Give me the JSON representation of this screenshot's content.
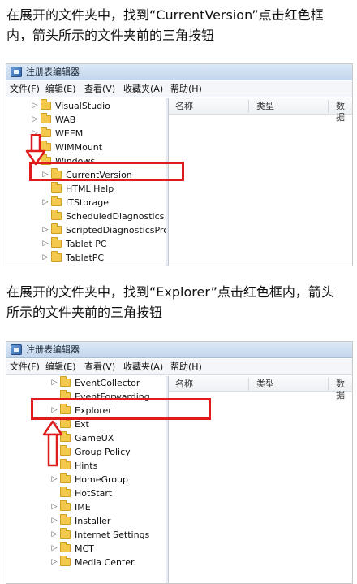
{
  "instructions": {
    "step1_line1": "在展开的文件夹中，找到“CurrentVersion”点击红色框",
    "step1_line2": "内，箭头所示的文件夹前的三角按钮",
    "step2_line1": "在展开的文件夹中，找到“Explorer”点击红色框内，箭头",
    "step2_line2": "所示的文件夹前的三角按钮"
  },
  "window": {
    "title": "注册表编辑器",
    "menu": [
      "文件(F)",
      "编辑(E)",
      "查看(V)",
      "收藏夹(A)",
      "帮助(H)"
    ],
    "columns": [
      "名称",
      "类型",
      "数据"
    ]
  },
  "screenshot1": {
    "tree": [
      {
        "label": "VisualStudio",
        "expander": "collapsed"
      },
      {
        "label": "WAB",
        "expander": "collapsed"
      },
      {
        "label": "WEEM",
        "expander": "collapsed"
      },
      {
        "label": "WIMMount",
        "expander": "collapsed"
      },
      {
        "label": "Windows",
        "expander": "expanded"
      },
      {
        "label": "CurrentVersion",
        "expander": "collapsed"
      },
      {
        "label": "HTML Help",
        "expander": "none"
      },
      {
        "label": "ITStorage",
        "expander": "collapsed"
      },
      {
        "label": "ScheduledDiagnostics",
        "expander": "none"
      },
      {
        "label": "ScriptedDiagnosticsPro",
        "expander": "collapsed"
      },
      {
        "label": "Tablet PC",
        "expander": "collapsed"
      },
      {
        "label": "TabletPC",
        "expander": "collapsed"
      }
    ],
    "highlighted": "CurrentVersion"
  },
  "screenshot2": {
    "tree": [
      {
        "label": "EventCollector",
        "expander": "collapsed"
      },
      {
        "label": "EventForwarding",
        "expander": "none"
      },
      {
        "label": "Explorer",
        "expander": "collapsed"
      },
      {
        "label": "Ext",
        "expander": "collapsed"
      },
      {
        "label": "GameUX",
        "expander": "collapsed"
      },
      {
        "label": "Group Policy",
        "expander": "collapsed"
      },
      {
        "label": "Hints",
        "expander": "none"
      },
      {
        "label": "HomeGroup",
        "expander": "collapsed"
      },
      {
        "label": "HotStart",
        "expander": "none"
      },
      {
        "label": "IME",
        "expander": "collapsed"
      },
      {
        "label": "Installer",
        "expander": "collapsed"
      },
      {
        "label": "Internet Settings",
        "expander": "collapsed"
      },
      {
        "label": "MCT",
        "expander": "collapsed"
      },
      {
        "label": "Media Center",
        "expander": "collapsed"
      }
    ],
    "highlighted": "Explorer"
  },
  "colors": {
    "highlight": "#e01b1b",
    "folder": "#f2c94c",
    "titlebar": "#c3d6ec"
  }
}
